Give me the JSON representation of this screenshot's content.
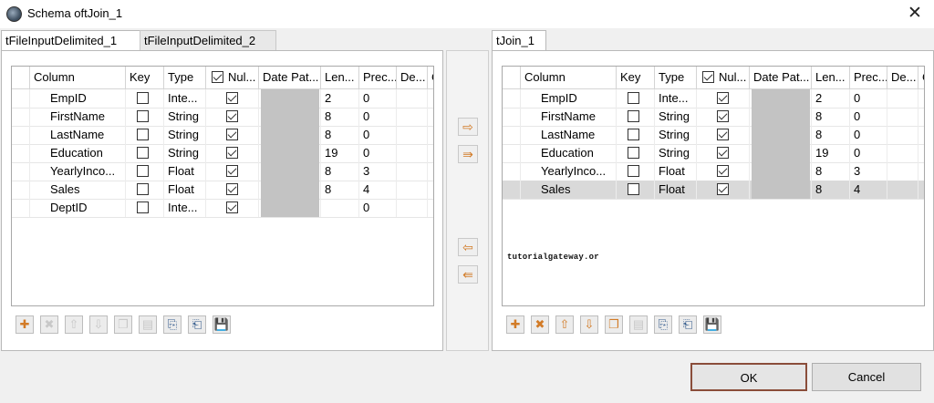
{
  "window": {
    "title": "Schema oftJoin_1",
    "close": "✕"
  },
  "left": {
    "tabs": [
      "tFileInputDelimited_1",
      "tFileInputDelimited_2"
    ],
    "headers": [
      "Column",
      "Key",
      "Type",
      "Nul...",
      "Date Pat...",
      "Len...",
      "Prec...",
      "De...",
      "C"
    ],
    "rows": [
      {
        "column": "EmpID",
        "key": false,
        "type": "Inte...",
        "nullable": true,
        "length": "2",
        "precision": "0"
      },
      {
        "column": "FirstName",
        "key": false,
        "type": "String",
        "nullable": true,
        "length": "8",
        "precision": "0"
      },
      {
        "column": "LastName",
        "key": false,
        "type": "String",
        "nullable": true,
        "length": "8",
        "precision": "0"
      },
      {
        "column": "Education",
        "key": false,
        "type": "String",
        "nullable": true,
        "length": "19",
        "precision": "0"
      },
      {
        "column": "YearlyInco...",
        "key": false,
        "type": "Float",
        "nullable": true,
        "length": "8",
        "precision": "3"
      },
      {
        "column": "Sales",
        "key": false,
        "type": "Float",
        "nullable": true,
        "length": "8",
        "precision": "4"
      },
      {
        "column": "DeptID",
        "key": false,
        "type": "Inte...",
        "nullable": true,
        "length": "",
        "precision": "0"
      }
    ]
  },
  "right": {
    "tabs": [
      "tJoin_1"
    ],
    "headers": [
      "Column",
      "Key",
      "Type",
      "Nul...",
      "Date Pat...",
      "Len...",
      "Prec...",
      "De...",
      "C"
    ],
    "rows": [
      {
        "column": "EmpID",
        "key": false,
        "type": "Inte...",
        "nullable": true,
        "length": "2",
        "precision": "0"
      },
      {
        "column": "FirstName",
        "key": false,
        "type": "String",
        "nullable": true,
        "length": "8",
        "precision": "0"
      },
      {
        "column": "LastName",
        "key": false,
        "type": "String",
        "nullable": true,
        "length": "8",
        "precision": "0"
      },
      {
        "column": "Education",
        "key": false,
        "type": "String",
        "nullable": true,
        "length": "19",
        "precision": "0"
      },
      {
        "column": "YearlyInco...",
        "key": false,
        "type": "Float",
        "nullable": true,
        "length": "8",
        "precision": "3"
      },
      {
        "column": "Sales",
        "key": false,
        "type": "Float",
        "nullable": true,
        "length": "8",
        "precision": "4",
        "selected": true
      }
    ]
  },
  "middle": {
    "buttons": [
      "⇨",
      "⇛",
      "⇦",
      "⇚"
    ]
  },
  "toolbar_icons": {
    "add": "✚",
    "remove": "✖",
    "up": "⇧",
    "down": "⇩",
    "copy": "❐",
    "paste": "▤",
    "import": "⎘",
    "export": "⎗",
    "save": "💾"
  },
  "watermark": "tutorialgateway.or",
  "buttons": {
    "ok": "OK",
    "cancel": "Cancel"
  }
}
